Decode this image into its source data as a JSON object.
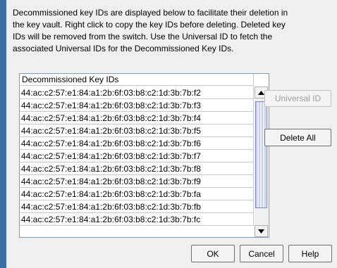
{
  "description": {
    "lines": [
      "Decommissioned key IDs are displayed below to facilitate their deletion in",
      "the key vault. Right click to copy the key IDs before deleting. Deleted key",
      "IDs will be removed from the switch. Use the Universal ID to fetch the",
      "associated Universal IDs for the Decommissioned Key IDs."
    ]
  },
  "list": {
    "header": "Decommissioned Key IDs",
    "rows": [
      "44:ac:c2:57:e1:84:a1:2b:6f:03:b8:c2:1d:3b:7b:f2",
      "44:ac:c2:57:e1:84:a1:2b:6f:03:b8:c2:1d:3b:7b:f3",
      "44:ac:c2:57:e1:84:a1:2b:6f:03:b8:c2:1d:3b:7b:f4",
      "44:ac:c2:57:e1:84:a1:2b:6f:03:b8:c2:1d:3b:7b:f5",
      "44:ac:c2:57:e1:84:a1:2b:6f:03:b8:c2:1d:3b:7b:f6",
      "44:ac:c2:57:e1:84:a1:2b:6f:03:b8:c2:1d:3b:7b:f7",
      "44:ac:c2:57:e1:84:a1:2b:6f:03:b8:c2:1d:3b:7b:f8",
      "44:ac:c2:57:e1:84:a1:2b:6f:03:b8:c2:1d:3b:7b:f9",
      "44:ac:c2:57:e1:84:a1:2b:6f:03:b8:c2:1d:3b:7b:fa",
      "44:ac:c2:57:e1:84:a1:2b:6f:03:b8:c2:1d:3b:7b:fb",
      "44:ac:c2:57:e1:84:a1:2b:6f:03:b8:c2:1d:3b:7b:fc"
    ]
  },
  "buttons": {
    "universal_id": "Universal ID",
    "delete_all": "Delete All",
    "ok": "OK",
    "cancel": "Cancel",
    "help": "Help"
  },
  "icons": {
    "scroll_up": "scroll-up-arrow-icon",
    "scroll_down": "scroll-down-arrow-icon"
  },
  "colors": {
    "window_edge": "#3a6ea5",
    "list_border": "#7f9db9",
    "scroll_thumb": "#c9cfe8"
  }
}
